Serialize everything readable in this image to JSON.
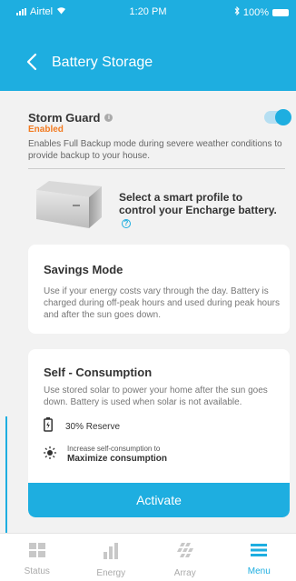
{
  "status_bar": {
    "carrier": "Airtel",
    "time": "1:20 PM",
    "battery": "100%"
  },
  "header": {
    "title": "Battery Storage"
  },
  "storm_guard": {
    "title": "Storm Guard",
    "status": "Enabled",
    "toggle_on": true,
    "description": "Enables Full Backup mode during severe weather conditions to provide backup to your house."
  },
  "profile_prompt": {
    "text": "Select a smart profile to control your Encharge battery."
  },
  "savings_mode": {
    "title": "Savings Mode",
    "description": "Use if your energy costs vary through the day. Battery is charged during off-peak hours and used during peak hours and after the sun goes down."
  },
  "self_consumption": {
    "title": "Self - Consumption",
    "description": "Use stored solar to power your home after the sun goes down. Battery is used when solar is not available.",
    "reserve_label": "30% Reserve",
    "increase_label": "Increase self-consumption to",
    "maximize_label": "Maximize consumption",
    "activate_label": "Activate"
  },
  "tabs": [
    {
      "label": "Status",
      "icon": "status-icon",
      "active": false
    },
    {
      "label": "Energy",
      "icon": "energy-icon",
      "active": false
    },
    {
      "label": "Array",
      "icon": "array-icon",
      "active": false
    },
    {
      "label": "Menu",
      "icon": "menu-icon",
      "active": true
    }
  ],
  "colors": {
    "accent": "#1eaee0",
    "enabled": "#f27b21",
    "background": "#f2f2f2"
  }
}
